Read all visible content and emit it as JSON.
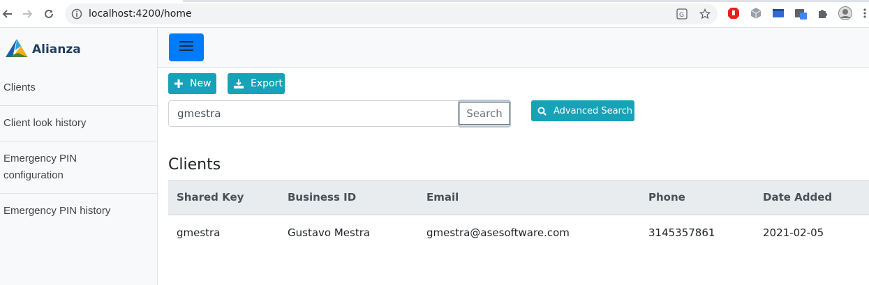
{
  "browser": {
    "url": "localhost:4200/home"
  },
  "sidebar": {
    "brand": "Alianza",
    "items": [
      {
        "label": "Clients"
      },
      {
        "label": "Client look history"
      },
      {
        "label": "Emergency PIN configuration"
      },
      {
        "label": "Emergency PIN history"
      }
    ]
  },
  "toolbar": {
    "new_label": "New",
    "export_label": "Export",
    "advanced_search_label": "Advanced Search"
  },
  "search": {
    "value": "gmestra",
    "button_label": "Search"
  },
  "clients": {
    "title": "Clients",
    "columns": [
      "Shared Key",
      "Business ID",
      "Email",
      "Phone",
      "Date Added"
    ],
    "rows": [
      {
        "shared_key": "gmestra",
        "business_id": "Gustavo Mestra",
        "email": "gmestra@asesoftware.com",
        "phone": "3145357861",
        "date_added": "2021-02-05"
      }
    ]
  },
  "colors": {
    "primary": "#007bff",
    "teal": "#17a2b8",
    "sidebar_bg": "#f8f9fa"
  }
}
